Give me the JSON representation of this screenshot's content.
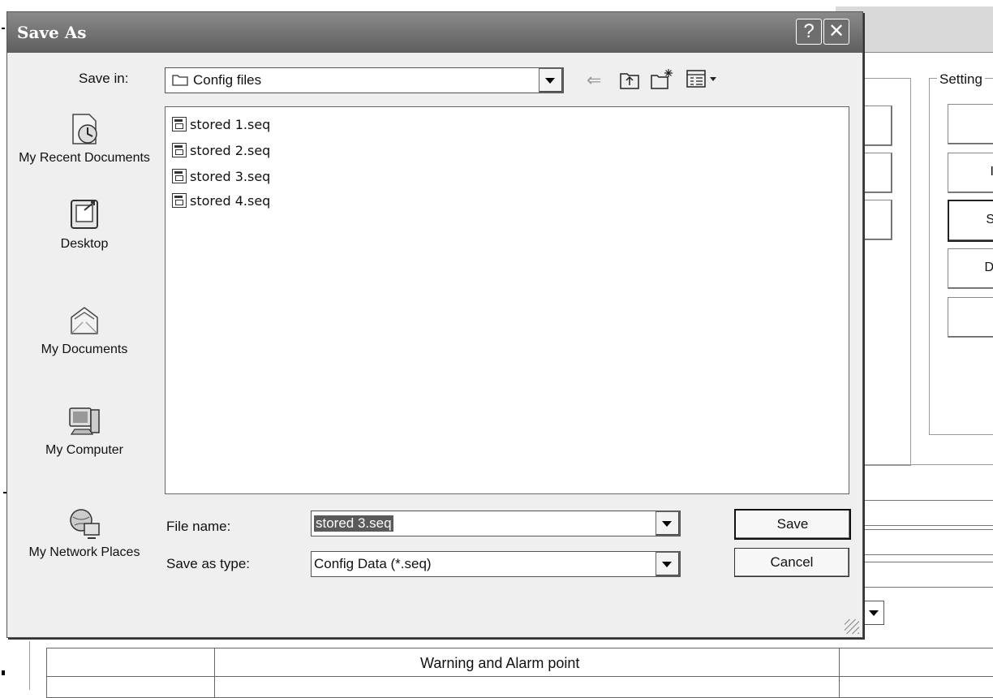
{
  "background_app": {
    "group_label": "Setting",
    "table_header": "Warning and Alarm point",
    "buttons_right": [
      "",
      "I",
      "S",
      "D",
      ""
    ]
  },
  "dialog": {
    "title": "Save As",
    "help_label": "?",
    "close_label": "✕",
    "save_in_label": "Save in:",
    "save_in_value": "Config files",
    "places": [
      {
        "label": "My Recent Documents",
        "icon": "recent-documents-icon"
      },
      {
        "label": "Desktop",
        "icon": "desktop-icon"
      },
      {
        "label": "My Documents",
        "icon": "my-documents-icon"
      },
      {
        "label": "My Computer",
        "icon": "my-computer-icon"
      },
      {
        "label": "My Network Places",
        "icon": "network-places-icon"
      }
    ],
    "files": [
      "stored 1.seq",
      "stored 2.seq",
      "stored 3.seq",
      "stored 4.seq"
    ],
    "file_name_label": "File name:",
    "file_name_value": "stored 3.seq",
    "save_as_type_label": "Save as type:",
    "save_as_type_value": "Config Data (*.seq)",
    "save_button": "Save",
    "cancel_button": "Cancel"
  }
}
